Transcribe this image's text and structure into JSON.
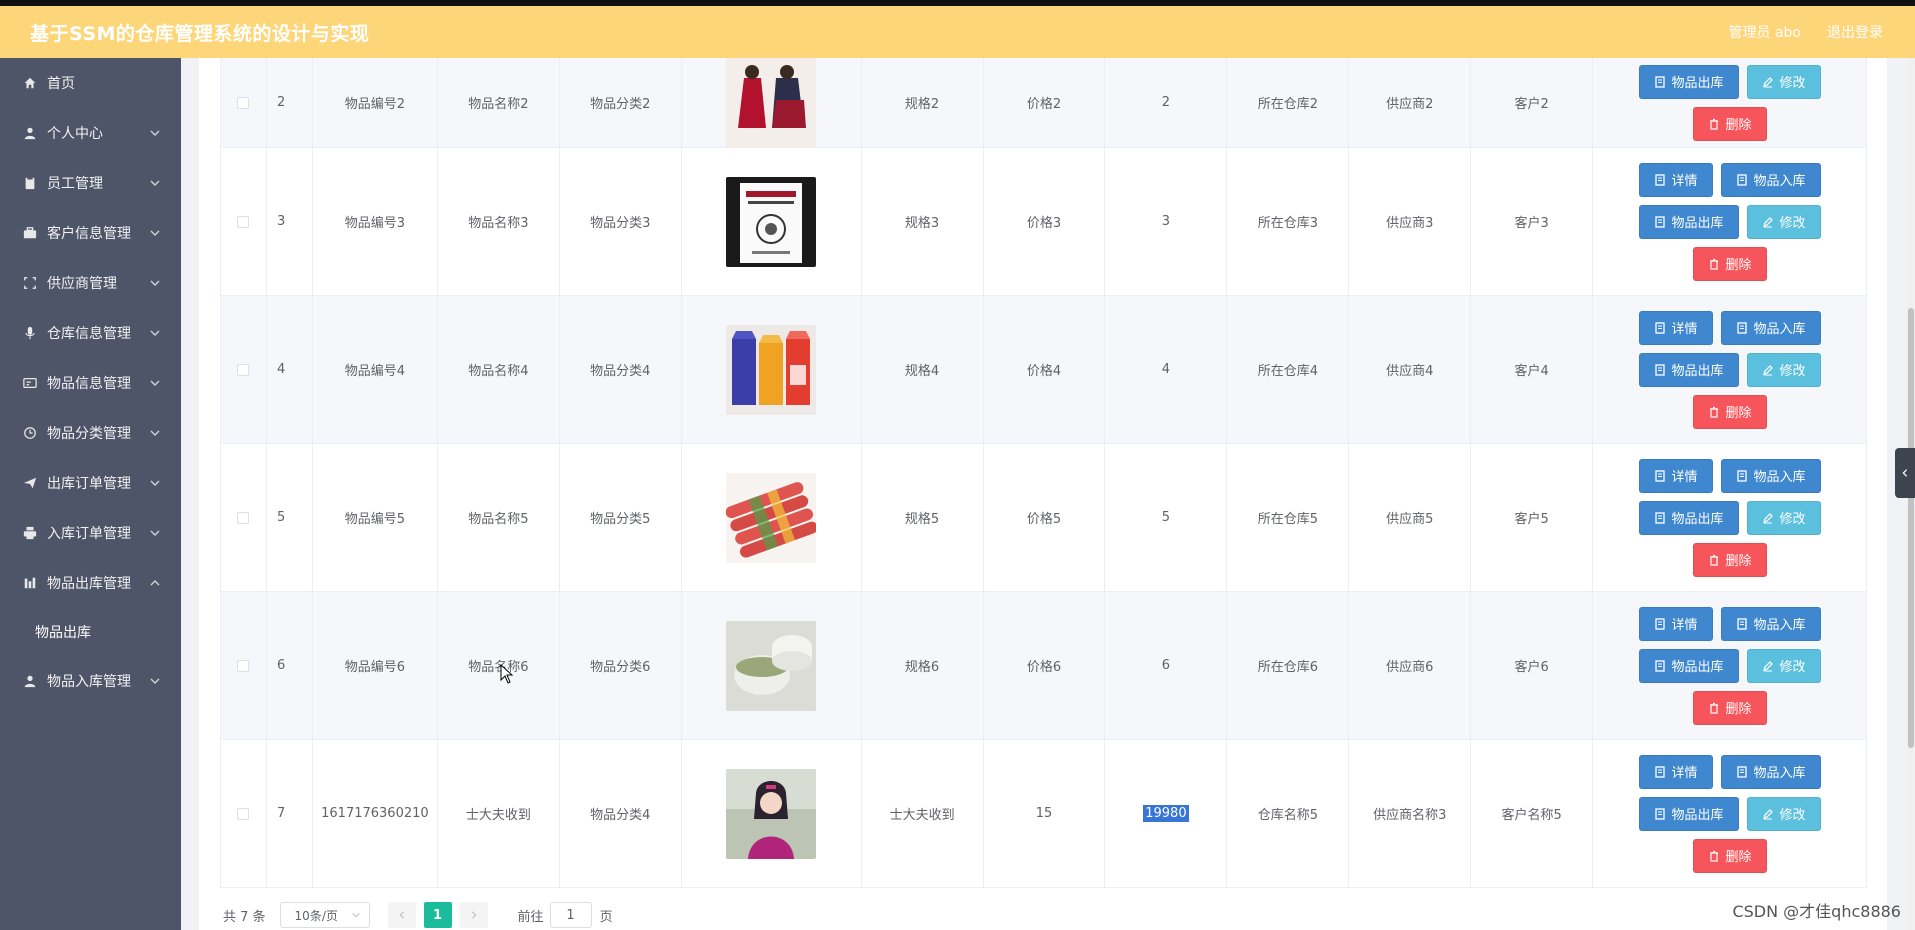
{
  "header": {
    "title": "基于SSM的仓库管理系统的设计与实现",
    "user": "管理员 abo",
    "logout": "退出登录"
  },
  "sidebar": {
    "items": [
      {
        "label": "首页",
        "icon": "home-icon"
      },
      {
        "label": "个人中心",
        "icon": "user-icon"
      },
      {
        "label": "员工管理",
        "icon": "clipboard-icon"
      },
      {
        "label": "客户信息管理",
        "icon": "briefcase-icon"
      },
      {
        "label": "供应商管理",
        "icon": "frame-icon"
      },
      {
        "label": "仓库信息管理",
        "icon": "mic-icon"
      },
      {
        "label": "物品信息管理",
        "icon": "card-icon"
      },
      {
        "label": "物品分类管理",
        "icon": "clock-icon"
      },
      {
        "label": "出库订单管理",
        "icon": "send-icon"
      },
      {
        "label": "入库订单管理",
        "icon": "printer-icon"
      },
      {
        "label": "物品出库管理",
        "icon": "bars-icon"
      },
      {
        "label": "物品入库管理",
        "icon": "user-icon"
      }
    ],
    "subitem": "物品出库"
  },
  "buttons": {
    "detail": "详情",
    "stock_in": "物品入库",
    "stock_out": "物品出库",
    "edit": "修改",
    "delete": "删除"
  },
  "rows": [
    {
      "index": "2",
      "code": "物品编号2",
      "name": "物品名称2",
      "category": "物品分类2",
      "image": "women-dresses",
      "spec": "规格2",
      "price": "价格2",
      "qty": "2",
      "warehouse": "所在仓库2",
      "supplier": "供应商2",
      "customer": "客户2"
    },
    {
      "index": "3",
      "code": "物品编号3",
      "name": "物品名称3",
      "category": "物品分类3",
      "image": "book-cover",
      "spec": "规格3",
      "price": "价格3",
      "qty": "3",
      "warehouse": "所在仓库3",
      "supplier": "供应商3",
      "customer": "客户3"
    },
    {
      "index": "4",
      "code": "物品编号4",
      "name": "物品名称4",
      "category": "物品分类4",
      "image": "juice-cartons",
      "spec": "规格4",
      "price": "价格4",
      "qty": "4",
      "warehouse": "所在仓库4",
      "supplier": "供应商4",
      "customer": "客户4"
    },
    {
      "index": "5",
      "code": "物品编号5",
      "name": "物品名称5",
      "category": "物品分类5",
      "image": "sausages",
      "spec": "规格5",
      "price": "价格5",
      "qty": "5",
      "warehouse": "所在仓库5",
      "supplier": "供应商5",
      "customer": "客户5"
    },
    {
      "index": "6",
      "code": "物品编号6",
      "name": "物品名称6",
      "category": "物品分类6",
      "image": "cream-jar",
      "spec": "规格6",
      "price": "价格6",
      "qty": "6",
      "warehouse": "所在仓库6",
      "supplier": "供应商6",
      "customer": "客户6"
    },
    {
      "index": "7",
      "code": "1617176360210",
      "name": "士大夫收到",
      "category": "物品分类4",
      "image": "woman-portrait",
      "spec": "士大夫收到",
      "price": "15",
      "qty": "19980",
      "warehouse": "仓库名称5",
      "supplier": "供应商名称3",
      "customer": "客户名称5"
    }
  ],
  "pagination": {
    "total": "共 7 条",
    "page_size": "10条/页",
    "current_page": "1",
    "goto_label": "前往",
    "goto_value": "1",
    "page_unit": "页"
  },
  "watermark": "CSDN @才佳qhc8886",
  "colors": {
    "header": "#fdd67a",
    "sidebar": "#4f5568",
    "primary_button": "#3f88cf",
    "edit_button": "#5bc0de",
    "delete_button": "#f5555b",
    "active_page": "#1abc9c"
  }
}
